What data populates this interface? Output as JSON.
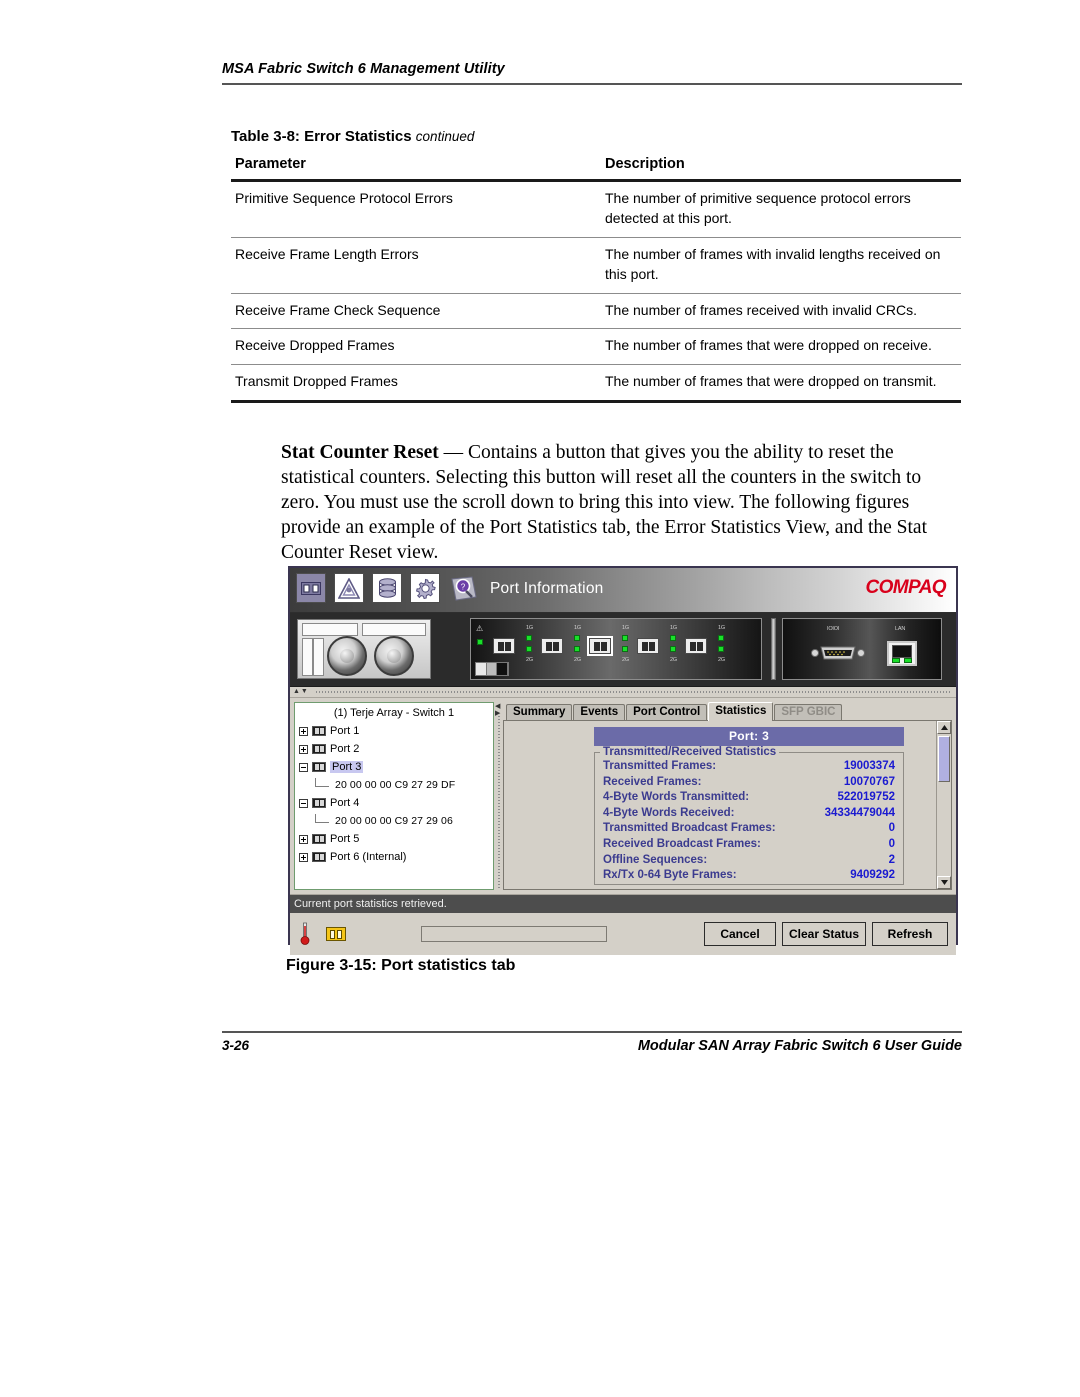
{
  "page": {
    "running_head": "MSA Fabric Switch 6 Management Utility",
    "footer_page_number": "3-26",
    "footer_guide_title": "Modular SAN Array Fabric Switch 6 User Guide"
  },
  "table": {
    "caption_main": "Table 3-8:  Error Statistics",
    "caption_continued": "continued",
    "headers": [
      "Parameter",
      "Description"
    ],
    "rows": [
      {
        "parameter": "Primitive Sequence Protocol Errors",
        "description": "The number of primitive sequence protocol errors detected at this port."
      },
      {
        "parameter": "Receive Frame Length Errors",
        "description": "The number of frames with invalid lengths received on this port."
      },
      {
        "parameter": "Receive Frame Check Sequence",
        "description": "The number of frames received with invalid CRCs."
      },
      {
        "parameter": "Receive Dropped Frames",
        "description": "The number of frames that were dropped on receive."
      },
      {
        "parameter": "Transmit Dropped Frames",
        "description": "The number of frames that were dropped on transmit."
      }
    ]
  },
  "body": {
    "term": "Stat Counter Reset",
    "dash": " — ",
    "text": "Contains a button that gives you the ability to reset the statistical counters. Selecting this button will reset all the counters in the switch to zero. You must use the scroll down to bring this into view. The following figures provide an example of the Port Statistics tab, the Error Statistics View, and the Stat Counter Reset view."
  },
  "figure": {
    "caption": "Figure 3-15:  Port statistics tab",
    "app": {
      "title": "Port Information",
      "brand": "COMPAQ",
      "brand_color": "#d9001b",
      "toolbar_icons": [
        "ports-icon",
        "fabric-icon",
        "database-icon",
        "gear-icon",
        "magnifier-icon"
      ],
      "hardware": {
        "psu_label": "power-supply-fans",
        "port_speed_top": "1G",
        "port_speed_bottom": "2G",
        "warn_glyph": "⚠",
        "serial_label": "IOIOI",
        "ethernet_label": "LAN"
      },
      "tree": {
        "root": "(1) Terje Array - Switch 1",
        "nodes": [
          {
            "label": "Port 1",
            "expanded": false,
            "selected": false,
            "children": []
          },
          {
            "label": "Port 2",
            "expanded": false,
            "selected": false,
            "children": []
          },
          {
            "label": "Port 3",
            "expanded": true,
            "selected": true,
            "children": [
              "20 00 00 00 C9 27 29 DF"
            ]
          },
          {
            "label": "Port 4",
            "expanded": true,
            "selected": false,
            "children": [
              "20 00 00 00 C9 27 29 06"
            ]
          },
          {
            "label": "Port 5",
            "expanded": false,
            "selected": false,
            "children": []
          },
          {
            "label": "Port 6 (Internal)",
            "expanded": false,
            "selected": false,
            "children": []
          }
        ]
      },
      "tabs": [
        {
          "label": "Summary",
          "active": false,
          "disabled": false
        },
        {
          "label": "Events",
          "active": false,
          "disabled": false
        },
        {
          "label": "Port Control",
          "active": false,
          "disabled": false
        },
        {
          "label": "Statistics",
          "active": true,
          "disabled": false
        },
        {
          "label": "SFP GBIC",
          "active": false,
          "disabled": true
        }
      ],
      "statistics": {
        "port_header": "Port: 3",
        "group_label": "Transmitted/Received Statistics",
        "label_color": "#3b3b8f",
        "value_color": "#1a1ad0",
        "header_bg": "#6b6ba8",
        "rows": [
          {
            "label": "Transmitted Frames:",
            "value": "19003374"
          },
          {
            "label": "Received Frames:",
            "value": "10070767"
          },
          {
            "label": "4-Byte Words Transmitted:",
            "value": "522019752"
          },
          {
            "label": "4-Byte Words Received:",
            "value": "34334479044"
          },
          {
            "label": "Transmitted Broadcast Frames:",
            "value": "0"
          },
          {
            "label": "Received Broadcast Frames:",
            "value": "0"
          },
          {
            "label": "Offline Sequences:",
            "value": "2"
          },
          {
            "label": "Rx/Tx 0-64 Byte Frames:",
            "value": "9409292"
          }
        ]
      },
      "status_message": "Current port statistics retrieved.",
      "buttons": {
        "cancel": "Cancel",
        "clear_status": "Clear Status",
        "refresh": "Refresh"
      }
    }
  }
}
